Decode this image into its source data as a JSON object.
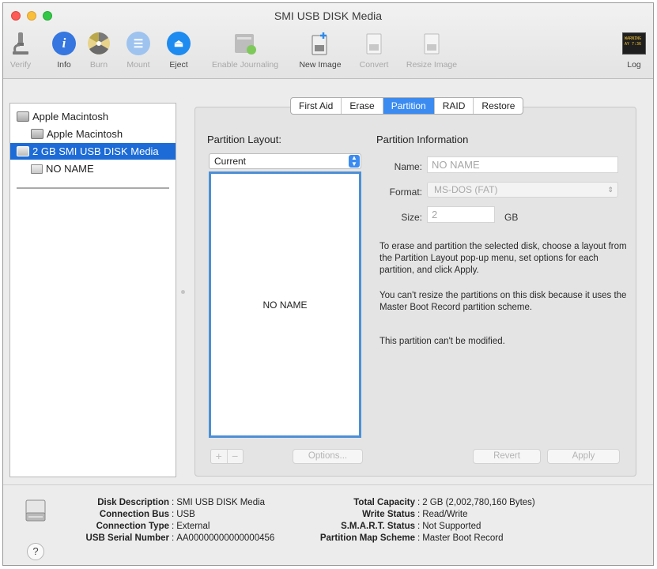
{
  "window": {
    "title": "SMI USB DISK Media"
  },
  "toolbar": {
    "items": [
      {
        "label": "Verify",
        "icon": "microscope-icon",
        "enabled": false
      },
      {
        "label": "Info",
        "icon": "info-icon",
        "enabled": true
      },
      {
        "label": "Burn",
        "icon": "burn-icon",
        "enabled": false
      },
      {
        "label": "Mount",
        "icon": "mount-icon",
        "enabled": false
      },
      {
        "label": "Eject",
        "icon": "eject-icon",
        "enabled": true
      },
      {
        "label": "Enable Journaling",
        "icon": "journaling-icon",
        "enabled": false
      },
      {
        "label": "New Image",
        "icon": "new-image-icon",
        "enabled": true
      },
      {
        "label": "Convert",
        "icon": "convert-icon",
        "enabled": false
      },
      {
        "label": "Resize Image",
        "icon": "resize-image-icon",
        "enabled": false
      }
    ],
    "log": {
      "label": "Log",
      "badge_line1": "WARNING",
      "badge_line2": "AY 7:36"
    }
  },
  "sidebar": {
    "items": [
      {
        "label": "Apple Macintosh",
        "kind": "disk",
        "level": 0
      },
      {
        "label": "Apple Macintosh",
        "kind": "volume",
        "level": 1
      },
      {
        "label": "2 GB SMI USB DISK Media",
        "kind": "disk",
        "level": 0,
        "selected": true
      },
      {
        "label": "NO NAME",
        "kind": "volume",
        "level": 1
      }
    ]
  },
  "tabs": [
    {
      "label": "First Aid"
    },
    {
      "label": "Erase"
    },
    {
      "label": "Partition",
      "active": true
    },
    {
      "label": "RAID"
    },
    {
      "label": "Restore"
    }
  ],
  "partition": {
    "layout_heading": "Partition Layout:",
    "layout_value": "Current",
    "map_label": "NO NAME",
    "add_symbol": "+",
    "remove_symbol": "−",
    "options_label": "Options...",
    "info_heading": "Partition Information",
    "name_label": "Name:",
    "name_value": "NO NAME",
    "format_label": "Format:",
    "format_value": "MS-DOS (FAT)",
    "size_label": "Size:",
    "size_value": "2",
    "size_unit": "GB",
    "help_1": "To erase and partition the selected disk, choose a layout from the Partition Layout pop-up menu, set options for each partition, and click Apply.",
    "help_2": "You can't resize the partitions on this disk because it uses the Master Boot Record partition scheme.",
    "help_3": "This partition can't be modified.",
    "revert_label": "Revert",
    "apply_label": "Apply"
  },
  "details": {
    "left": [
      {
        "key": "Disk Description",
        "value": "SMI USB DISK Media"
      },
      {
        "key": "Connection Bus",
        "value": "USB"
      },
      {
        "key": "Connection Type",
        "value": "External"
      },
      {
        "key": "USB Serial Number",
        "value": "AA00000000000000456"
      }
    ],
    "right": [
      {
        "key": "Total Capacity",
        "value": "2 GB (2,002,780,160 Bytes)"
      },
      {
        "key": "Write Status",
        "value": "Read/Write"
      },
      {
        "key": "S.M.A.R.T. Status",
        "value": "Not Supported"
      },
      {
        "key": "Partition Map Scheme",
        "value": "Master Boot Record"
      }
    ],
    "help_symbol": "?"
  },
  "colors": {
    "selection": "#1c6bd6",
    "tab_active": "#3b8bf0",
    "info_blue": "#3576e0",
    "eject_blue": "#1d8bf0"
  }
}
